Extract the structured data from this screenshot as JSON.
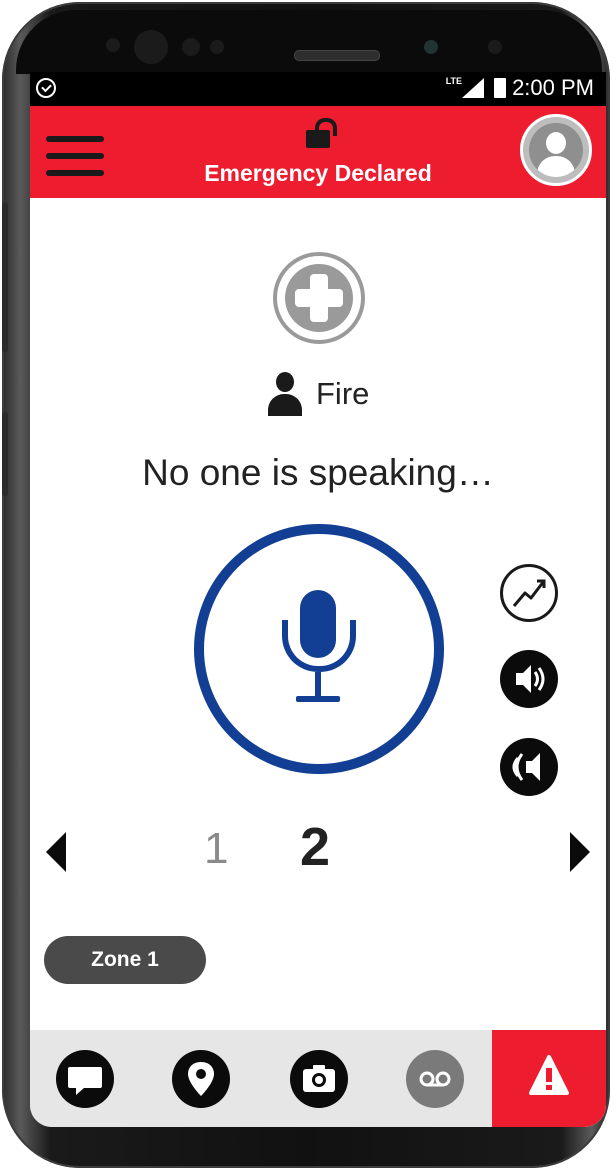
{
  "status_bar": {
    "network_label": "LTE",
    "time": "2:00 PM"
  },
  "header": {
    "title": "Emergency Declared"
  },
  "group": {
    "name": "Fire"
  },
  "speaker_status": "No one is speaking…",
  "channels": {
    "left": "1",
    "current": "2"
  },
  "zone": {
    "label": "Zone 1"
  },
  "colors": {
    "header_red": "#ed1c2e",
    "ptt_blue": "#123f94",
    "dark": "#0b0b0b",
    "grey": "#9a9a9a"
  },
  "icons": {
    "status_app": "check-circle-icon",
    "menu": "hamburger-menu-icon",
    "lock": "unlocked-padlock-icon",
    "avatar": "user-avatar-icon",
    "group_type": "medical-cross-icon",
    "group_member": "person-icon",
    "ptt": "microphone-icon",
    "scan": "scan-signal-icon",
    "volume": "speaker-volume-icon",
    "priority": "priority-speaker-icon",
    "nav": [
      "chat-bubble-icon",
      "location-pin-icon",
      "camera-icon",
      "voicemail-icon",
      "warning-triangle-icon"
    ]
  }
}
